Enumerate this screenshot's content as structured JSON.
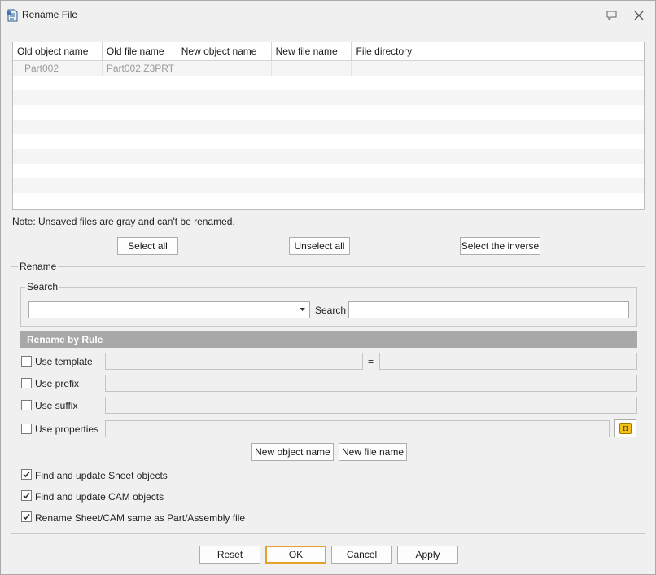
{
  "window": {
    "title": "Rename File"
  },
  "table": {
    "columns": [
      "Old object name",
      "Old file name",
      "New object name",
      "New file name",
      "File directory"
    ],
    "rows": [
      [
        "Part002",
        "Part002.Z3PRT",
        "",
        "",
        ""
      ]
    ]
  },
  "note": "Note: Unsaved files are gray and can't be renamed.",
  "selection": {
    "select_all": "Select all",
    "unselect_all": "Unselect all",
    "select_inverse": "Select the inverse"
  },
  "rename": {
    "label": "Rename",
    "search": {
      "group_label": "Search",
      "combo_value": "",
      "search_label": "Search",
      "search_value": ""
    },
    "rule_header": "Rename by Rule",
    "use_template": {
      "label": "Use template",
      "checked": false,
      "value_left": "",
      "equals": "=",
      "value_right": ""
    },
    "use_prefix": {
      "label": "Use prefix",
      "checked": false,
      "value": ""
    },
    "use_suffix": {
      "label": "Use suffix",
      "checked": false,
      "value": ""
    },
    "use_properties": {
      "label": "Use properties",
      "checked": false,
      "value": "",
      "button_icon": "pi-icon",
      "button_glyph": "π"
    },
    "new_object_name": "New object name",
    "new_file_name": "New file name",
    "find_sheet": {
      "label": "Find and update Sheet objects",
      "checked": true
    },
    "find_cam": {
      "label": "Find and update CAM objects",
      "checked": true
    },
    "rename_same": {
      "label": "Rename Sheet/CAM same as Part/Assembly file",
      "checked": true
    }
  },
  "footer": {
    "reset": "Reset",
    "ok": "OK",
    "cancel": "Cancel",
    "apply": "Apply"
  },
  "icons": {
    "app": "rename-file-icon",
    "feedback": "feedback-icon",
    "close": "close-icon",
    "dropdown": "chevron-down-icon",
    "check": "check-icon"
  },
  "colors": {
    "accent_border": "#e3a32a",
    "section_bar": "#a8a8a8",
    "unsaved_text": "#9a9a9a"
  }
}
